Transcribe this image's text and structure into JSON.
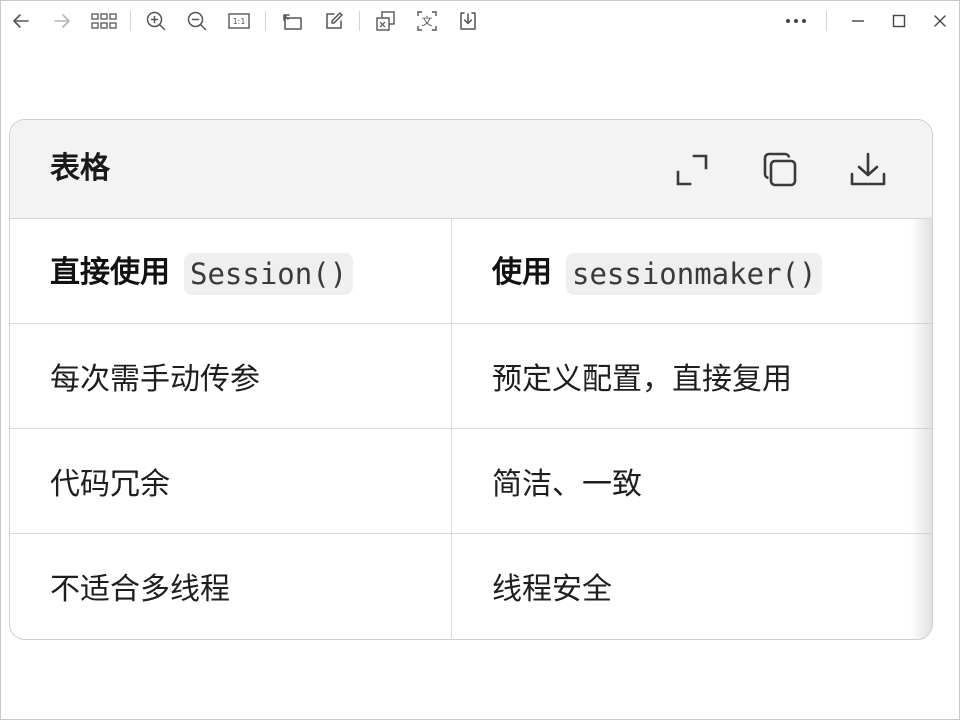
{
  "toolbar": {
    "left_icons": [
      "back-arrow-icon",
      "forward-arrow-icon",
      "grid-view-icon",
      "zoom-in-icon",
      "zoom-out-icon",
      "actual-size-icon",
      "rotate-icon",
      "edit-icon",
      "copy-image-icon",
      "translate-icon",
      "download-icon"
    ],
    "translate_glyph": "文",
    "actual_size_glyph": "1:1",
    "window_controls": [
      "more-icon",
      "minimize-icon",
      "maximize-icon",
      "close-icon"
    ]
  },
  "card": {
    "title": "表格",
    "actions": [
      "expand-icon",
      "copy-icon",
      "download-icon"
    ],
    "columns": [
      {
        "label": "直接使用",
        "code": "Session()"
      },
      {
        "label": "使用",
        "code": "sessionmaker()"
      }
    ],
    "rows": [
      [
        "每次需手动传参",
        "预定义配置，直接复用"
      ],
      [
        "代码冗余",
        "简洁、一致"
      ],
      [
        "不适合多线程",
        "线程安全"
      ]
    ]
  },
  "colors": {
    "header_bg": "#f3f3f3",
    "border": "#d9d9d9",
    "code_bg": "#efefef",
    "icon": "#555555"
  }
}
